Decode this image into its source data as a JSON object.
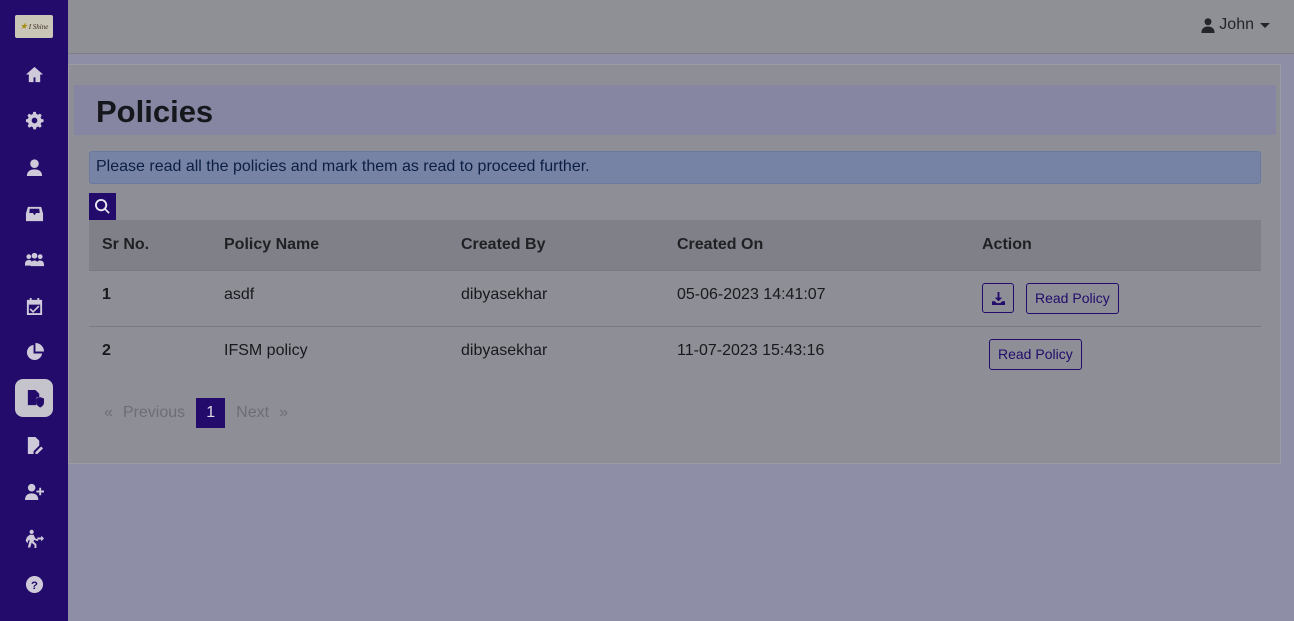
{
  "app": {
    "logo_text": "I Shine"
  },
  "sidebar": {
    "items": [
      {
        "icon": "home-icon"
      },
      {
        "icon": "gear-icon"
      },
      {
        "icon": "user-icon"
      },
      {
        "icon": "inbox-icon"
      },
      {
        "icon": "team-icon"
      },
      {
        "icon": "calendar-check-icon"
      },
      {
        "icon": "pie-chart-icon"
      },
      {
        "icon": "policy-file-shield-icon",
        "active": true
      },
      {
        "icon": "file-edit-icon"
      },
      {
        "icon": "user-plus-icon"
      },
      {
        "icon": "exit-icon"
      },
      {
        "icon": "help-icon"
      }
    ]
  },
  "topbar": {
    "user_name": "John"
  },
  "page": {
    "title": "Policies",
    "alert": "Please read all the policies and mark them as read to proceed further."
  },
  "table": {
    "headers": [
      "Sr No.",
      "Policy Name",
      "Created By",
      "Created On",
      "Action"
    ],
    "rows": [
      {
        "sr": "1",
        "name": "asdf",
        "created_by": "dibyasekhar",
        "created_on": "05-06-2023 14:41:07",
        "has_download": true,
        "action_label": "Read Policy"
      },
      {
        "sr": "2",
        "name": "IFSM policy",
        "created_by": "dibyasekhar",
        "created_on": "11-07-2023 15:43:16",
        "has_download": false,
        "action_label": "Read Policy"
      }
    ]
  },
  "pagination": {
    "prev_arrow": "«",
    "prev_label": "Previous",
    "current": "1",
    "next_label": "Next",
    "next_arrow": "»"
  },
  "colors": {
    "brand": "#220b6b",
    "overlay_bg": "#8e8fa6"
  }
}
